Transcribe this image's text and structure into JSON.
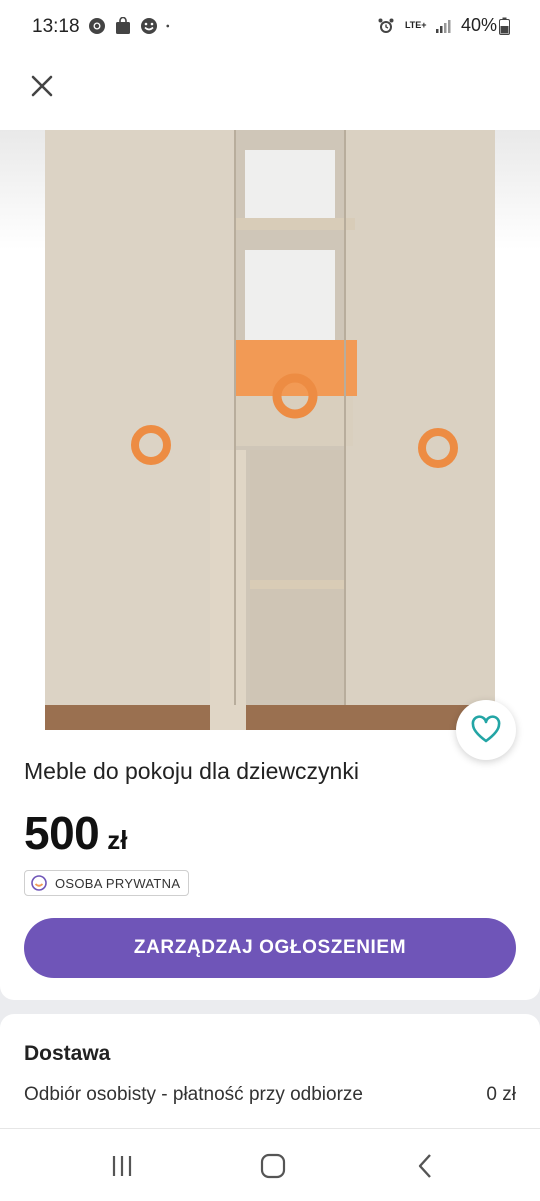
{
  "status_bar": {
    "time": "13:18",
    "network": "LTE+",
    "battery": "40%",
    "left_icons": [
      "chrome-icon",
      "shopping-bag-icon",
      "smiley-icon",
      "dot-icon"
    ],
    "right_icons": [
      "alarm-icon",
      "lte-icon",
      "signal-icon",
      "battery-icon"
    ]
  },
  "header": {
    "close_icon": "close-icon"
  },
  "listing": {
    "title": "Meble do pokoju dla dziewczynki",
    "price": "500",
    "currency": "zł",
    "seller_badge": "OSOBA PRYWATNA",
    "manage_button": "ZARZĄDZAJ OGŁOSZENIEM",
    "favorite_icon": "heart-icon"
  },
  "delivery": {
    "title": "Dostawa",
    "option": "Odbiór osobisty - płatność przy odbiorze",
    "cost": "0 zł"
  },
  "nav": [
    "recent-apps-icon",
    "home-icon",
    "back-icon"
  ],
  "colors": {
    "accent": "#6f55b8",
    "heart": "#23a5a5"
  }
}
